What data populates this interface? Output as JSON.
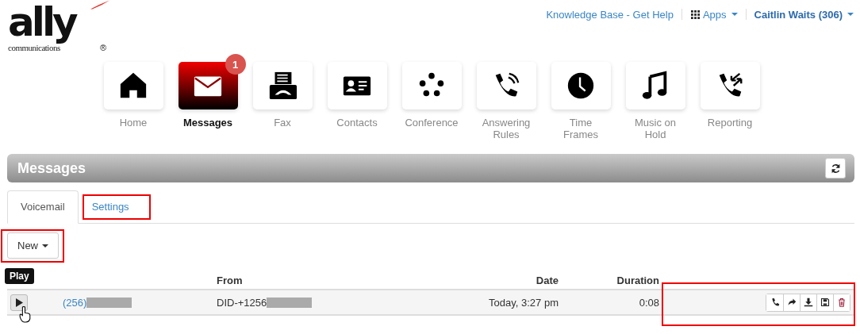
{
  "header": {
    "logo": {
      "wordmark": "ally",
      "tagline": "communications",
      "mark": "®"
    },
    "links": [
      {
        "kind": "link",
        "label": "Knowledge Base - Get Help"
      },
      {
        "kind": "apps",
        "label": "Apps"
      },
      {
        "kind": "user",
        "label": "Caitlin Waits (306)"
      }
    ]
  },
  "nav": [
    {
      "label": "Home",
      "selected": false
    },
    {
      "label": "Messages",
      "selected": true,
      "badge": "1"
    },
    {
      "label": "Fax",
      "selected": false
    },
    {
      "label": "Contacts",
      "selected": false
    },
    {
      "label": "Conference",
      "selected": false
    },
    {
      "label": "Answering Rules",
      "selected": false
    },
    {
      "label": "Time Frames",
      "selected": false
    },
    {
      "label": "Music on Hold",
      "selected": false
    },
    {
      "label": "Reporting",
      "selected": false
    }
  ],
  "panel": {
    "title": "Messages"
  },
  "tabs": [
    {
      "label": "Voicemail",
      "selected": true,
      "highlighted": false
    },
    {
      "label": "Settings",
      "selected": false,
      "highlighted": true
    }
  ],
  "new_button": {
    "label": "New",
    "highlighted": true
  },
  "tooltip": "Play",
  "table": {
    "columns": {
      "from": "From",
      "date": "Date",
      "duration": "Duration"
    },
    "rows": [
      {
        "caller": "(256)",
        "from": "DID-+1256",
        "date": "Today, 3:27 pm",
        "duration": "0:08",
        "redacted": true,
        "actions_highlighted": true
      }
    ]
  }
}
